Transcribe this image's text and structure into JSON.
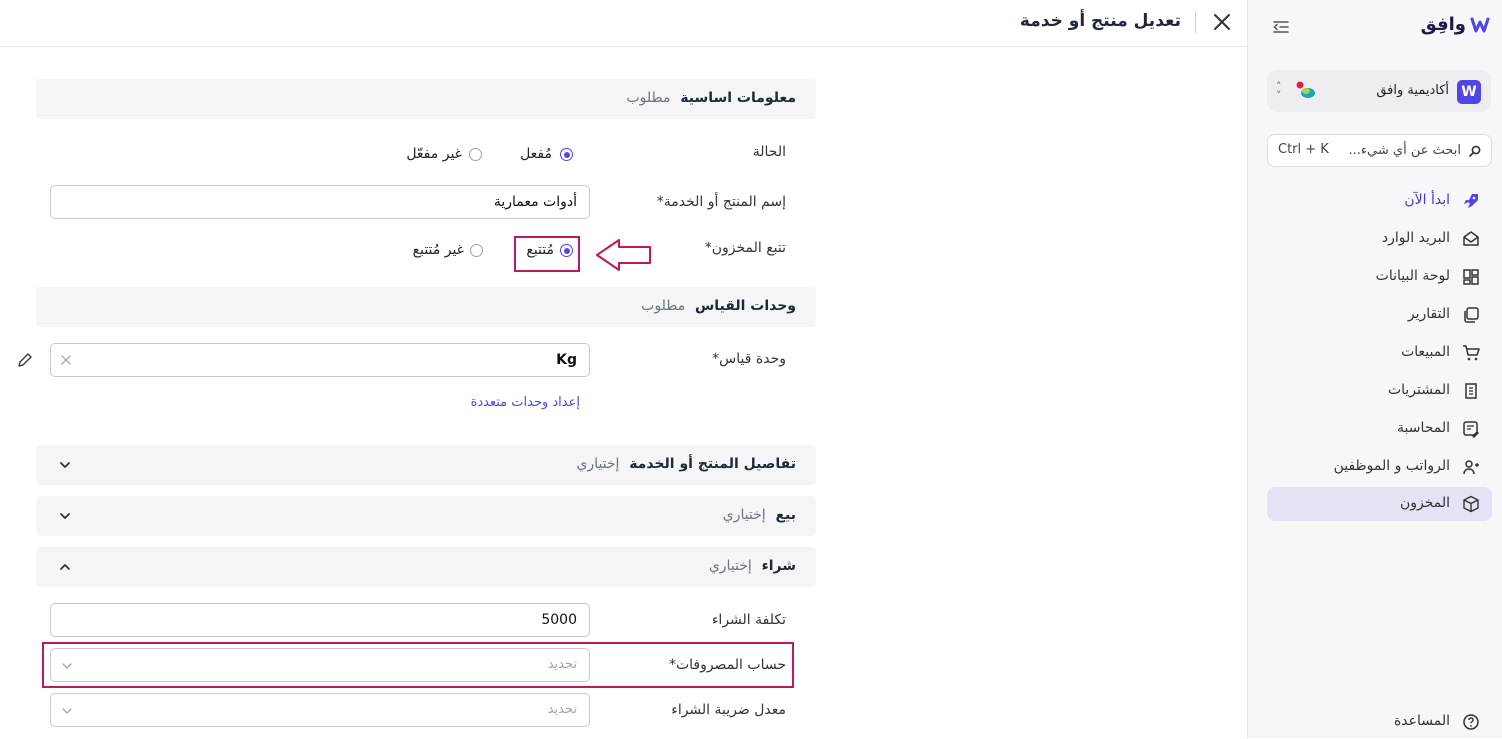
{
  "sidebar": {
    "logo_text": "وافِق",
    "org": {
      "badge": "W",
      "name": "أكاديمية وافق"
    },
    "search": {
      "placeholder": "ابحث عن أي شيء...",
      "shortcut": "Ctrl + K"
    },
    "items": [
      {
        "label": "ابدأ الآن",
        "icon": "rocket-icon"
      },
      {
        "label": "البريد الوارد",
        "icon": "inbox-icon"
      },
      {
        "label": "لوحة البيانات",
        "icon": "dashboard-icon"
      },
      {
        "label": "التقارير",
        "icon": "reports-icon"
      },
      {
        "label": "المبيعات",
        "icon": "cart-icon"
      },
      {
        "label": "المشتريات",
        "icon": "receipt-icon"
      },
      {
        "label": "المحاسبة",
        "icon": "ledger-icon"
      },
      {
        "label": "الرواتب و الموظفين",
        "icon": "users-icon"
      },
      {
        "label": "المخزون",
        "icon": "box-icon"
      }
    ],
    "help_label": "المساعدة"
  },
  "header": {
    "title": "تعديل منتج أو خدمة"
  },
  "sections": {
    "basic": {
      "title": "معلومات اساسية",
      "tag": "مطلوب"
    },
    "units": {
      "title": "وحدات القياس",
      "tag": "مطلوب"
    },
    "details": {
      "title": "تفاصيل المنتج أو الخدمة",
      "tag": "إختياري"
    },
    "sell": {
      "title": "بيع",
      "tag": "إختياري"
    },
    "purchase": {
      "title": "شراء",
      "tag": "إختياري"
    }
  },
  "form": {
    "status": {
      "label": "الحالة",
      "options": [
        "مُفعل",
        "غير مفعّل"
      ],
      "selected": "مُفعل"
    },
    "name": {
      "label": "إسم المنتج أو الخدمة*",
      "value": "أدوات معمارية"
    },
    "tracking": {
      "label": "تتبع المخزون*",
      "options": [
        "مُتتبع",
        "غير مُتتبع"
      ],
      "selected": "مُتتبع"
    },
    "unit": {
      "label": "وحدة قياس*",
      "value": "Kg"
    },
    "multi_units_link": "إعداد وحدات متعددة",
    "purchase_cost": {
      "label": "تكلفة الشراء",
      "value": "5000"
    },
    "expense_account": {
      "label": "حساب المصروفات*",
      "placeholder": "تحديد"
    },
    "purchase_tax": {
      "label": "معدل ضريبة الشراء",
      "placeholder": "تحديد"
    }
  },
  "colors": {
    "accent": "#4f46e5",
    "highlight": "#c2185b"
  }
}
